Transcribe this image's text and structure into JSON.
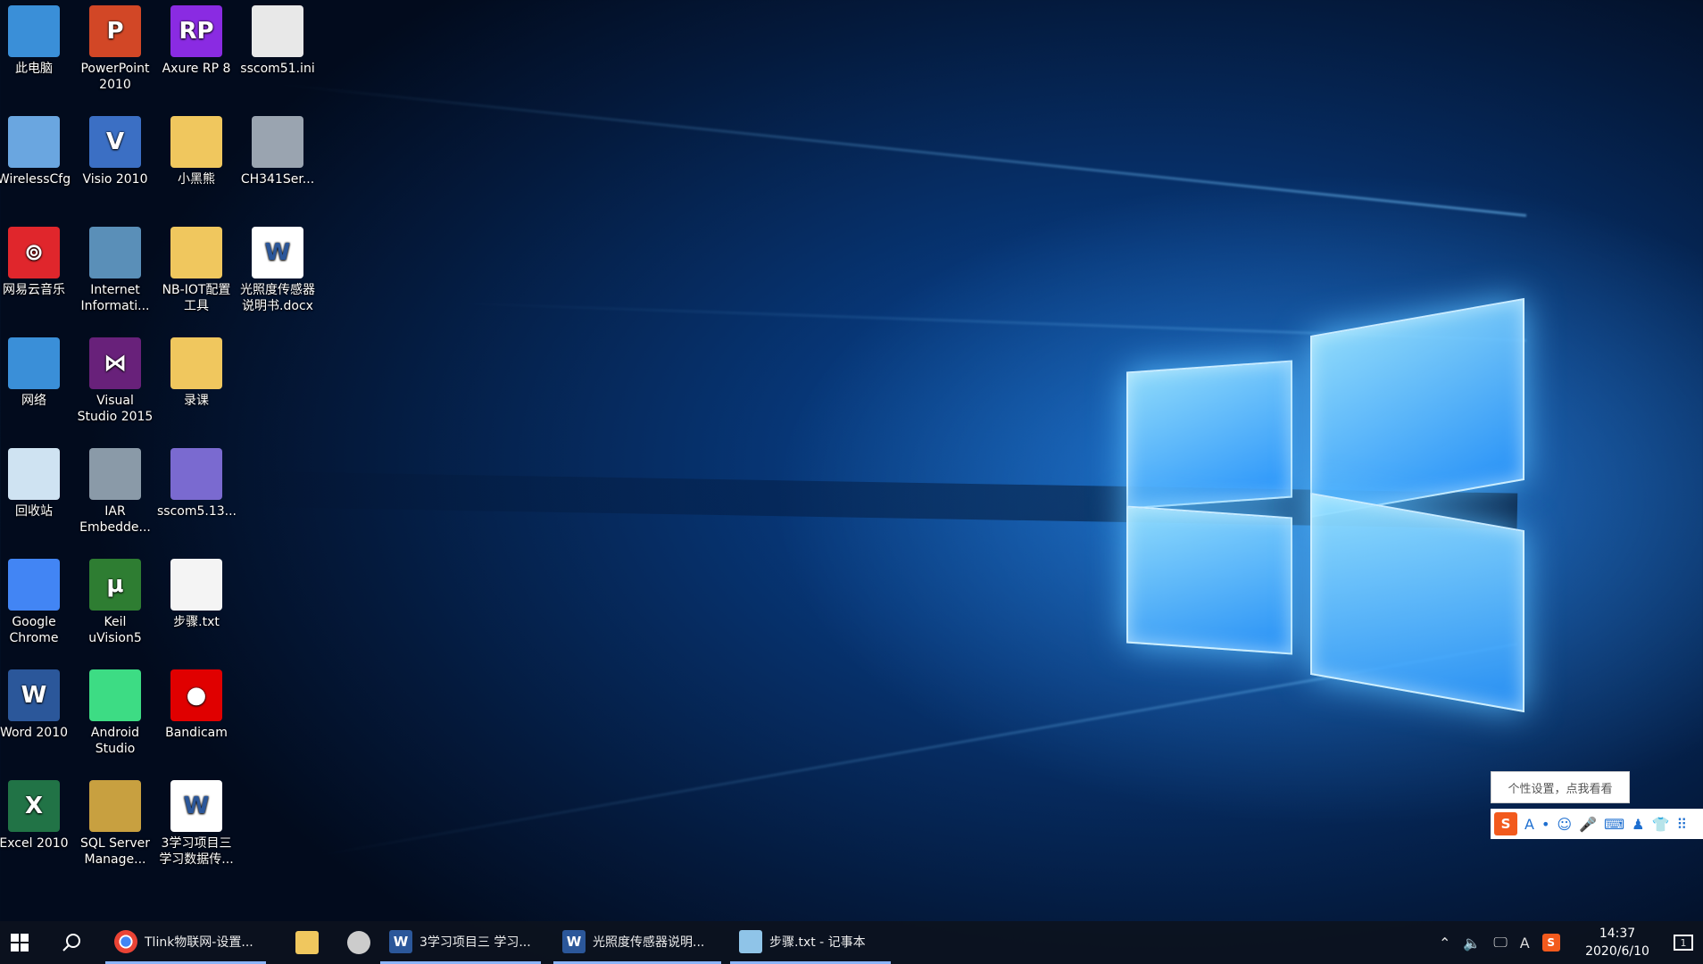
{
  "desktop_icons": [
    {
      "label": "此电脑",
      "icon": "computer-icon",
      "color": "#3a8fd8"
    },
    {
      "label": "PowerPoint\n2010",
      "icon": "powerpoint-icon",
      "color": "#d24726",
      "glyph": "P"
    },
    {
      "label": "Axure RP 8",
      "icon": "axure-icon",
      "color": "#8a2be2",
      "glyph": "RP"
    },
    {
      "label": "sscom51.ini",
      "icon": "ini-file-icon",
      "color": "#e8e8e8"
    },
    {
      "label": "WirelessCfg",
      "icon": "wireless-icon",
      "color": "#6aa6e0"
    },
    {
      "label": "Visio 2010",
      "icon": "visio-icon",
      "color": "#3b6fc4",
      "glyph": "V"
    },
    {
      "label": "小黑熊",
      "icon": "folder-icon",
      "color": "#f0c75e"
    },
    {
      "label": "CH341Ser...",
      "icon": "installer-icon",
      "color": "#9aa4b0"
    },
    {
      "label": "网易云音乐",
      "icon": "netease-music-icon",
      "color": "#e0262c",
      "glyph": "⊚"
    },
    {
      "label": "Internet\nInformati...",
      "icon": "iis-icon",
      "color": "#5a8fb8"
    },
    {
      "label": "NB-IOT配置\n工具",
      "icon": "folder-icon",
      "color": "#f0c75e"
    },
    {
      "label": "光照度传感器\n说明书.docx",
      "icon": "word-doc-icon",
      "color": "#ffffff",
      "glyph": "W"
    },
    {
      "label": "网络",
      "icon": "network-icon",
      "color": "#3a8fd8"
    },
    {
      "label": "Visual\nStudio 2015",
      "icon": "visual-studio-icon",
      "color": "#68217a",
      "glyph": "⋈"
    },
    {
      "label": "录课",
      "icon": "folder-icon",
      "color": "#f0c75e"
    },
    {
      "label": "回收站",
      "icon": "recycle-bin-icon",
      "color": "#cfe3f2"
    },
    {
      "label": "IAR\nEmbedde...",
      "icon": "iar-icon",
      "color": "#8a9aa8"
    },
    {
      "label": "sscom5.13...",
      "icon": "sscom-icon",
      "color": "#7a6ad0"
    },
    {
      "label": "Google\nChrome",
      "icon": "chrome-icon",
      "color": "#4285f4"
    },
    {
      "label": "Keil\nuVision5",
      "icon": "keil-icon",
      "color": "#2e7d32",
      "glyph": "μ"
    },
    {
      "label": "步骤.txt",
      "icon": "txt-file-icon",
      "color": "#f4f4f4"
    },
    {
      "label": "Word 2010",
      "icon": "word-icon",
      "color": "#2b579a",
      "glyph": "W"
    },
    {
      "label": "Android\nStudio",
      "icon": "android-studio-icon",
      "color": "#3ddc84"
    },
    {
      "label": "Bandicam",
      "icon": "bandicam-icon",
      "color": "#e00000",
      "glyph": "●"
    },
    {
      "label": "Excel 2010",
      "icon": "excel-icon",
      "color": "#217346",
      "glyph": "X"
    },
    {
      "label": "SQL Server\nManage...",
      "icon": "sql-server-icon",
      "color": "#c8a040"
    },
    {
      "label": "3学习项目三\n学习数据传...",
      "icon": "word-doc-icon",
      "color": "#ffffff",
      "glyph": "W"
    }
  ],
  "taskbar": {
    "apps": [
      {
        "label": "Tlink物联网-设置...",
        "icon": "chrome-icon",
        "color": "#4285f4"
      },
      {
        "label": "",
        "icon": "file-explorer-icon",
        "color": "#f0c75e"
      },
      {
        "label": "",
        "icon": "app-icon",
        "color": "#cccccc"
      },
      {
        "label": "3学习项目三 学习...",
        "icon": "word-icon",
        "color": "#2b579a",
        "glyph": "W"
      },
      {
        "label": "光照度传感器说明...",
        "icon": "word-icon",
        "color": "#2b579a",
        "glyph": "W"
      },
      {
        "label": "步骤.txt - 记事本",
        "icon": "notepad-icon",
        "color": "#8fc4e8"
      }
    ],
    "tray": {
      "ime_char": "A",
      "time": "14:37",
      "date": "2020/6/10",
      "notification_count": "1"
    }
  },
  "ime_tooltip": "个性设置，点我看看",
  "ime_toolbar": {
    "brand": "S",
    "items": [
      "A",
      "•",
      "☺",
      "🎤",
      "⌨",
      "♟",
      "👕",
      "⠿"
    ]
  }
}
